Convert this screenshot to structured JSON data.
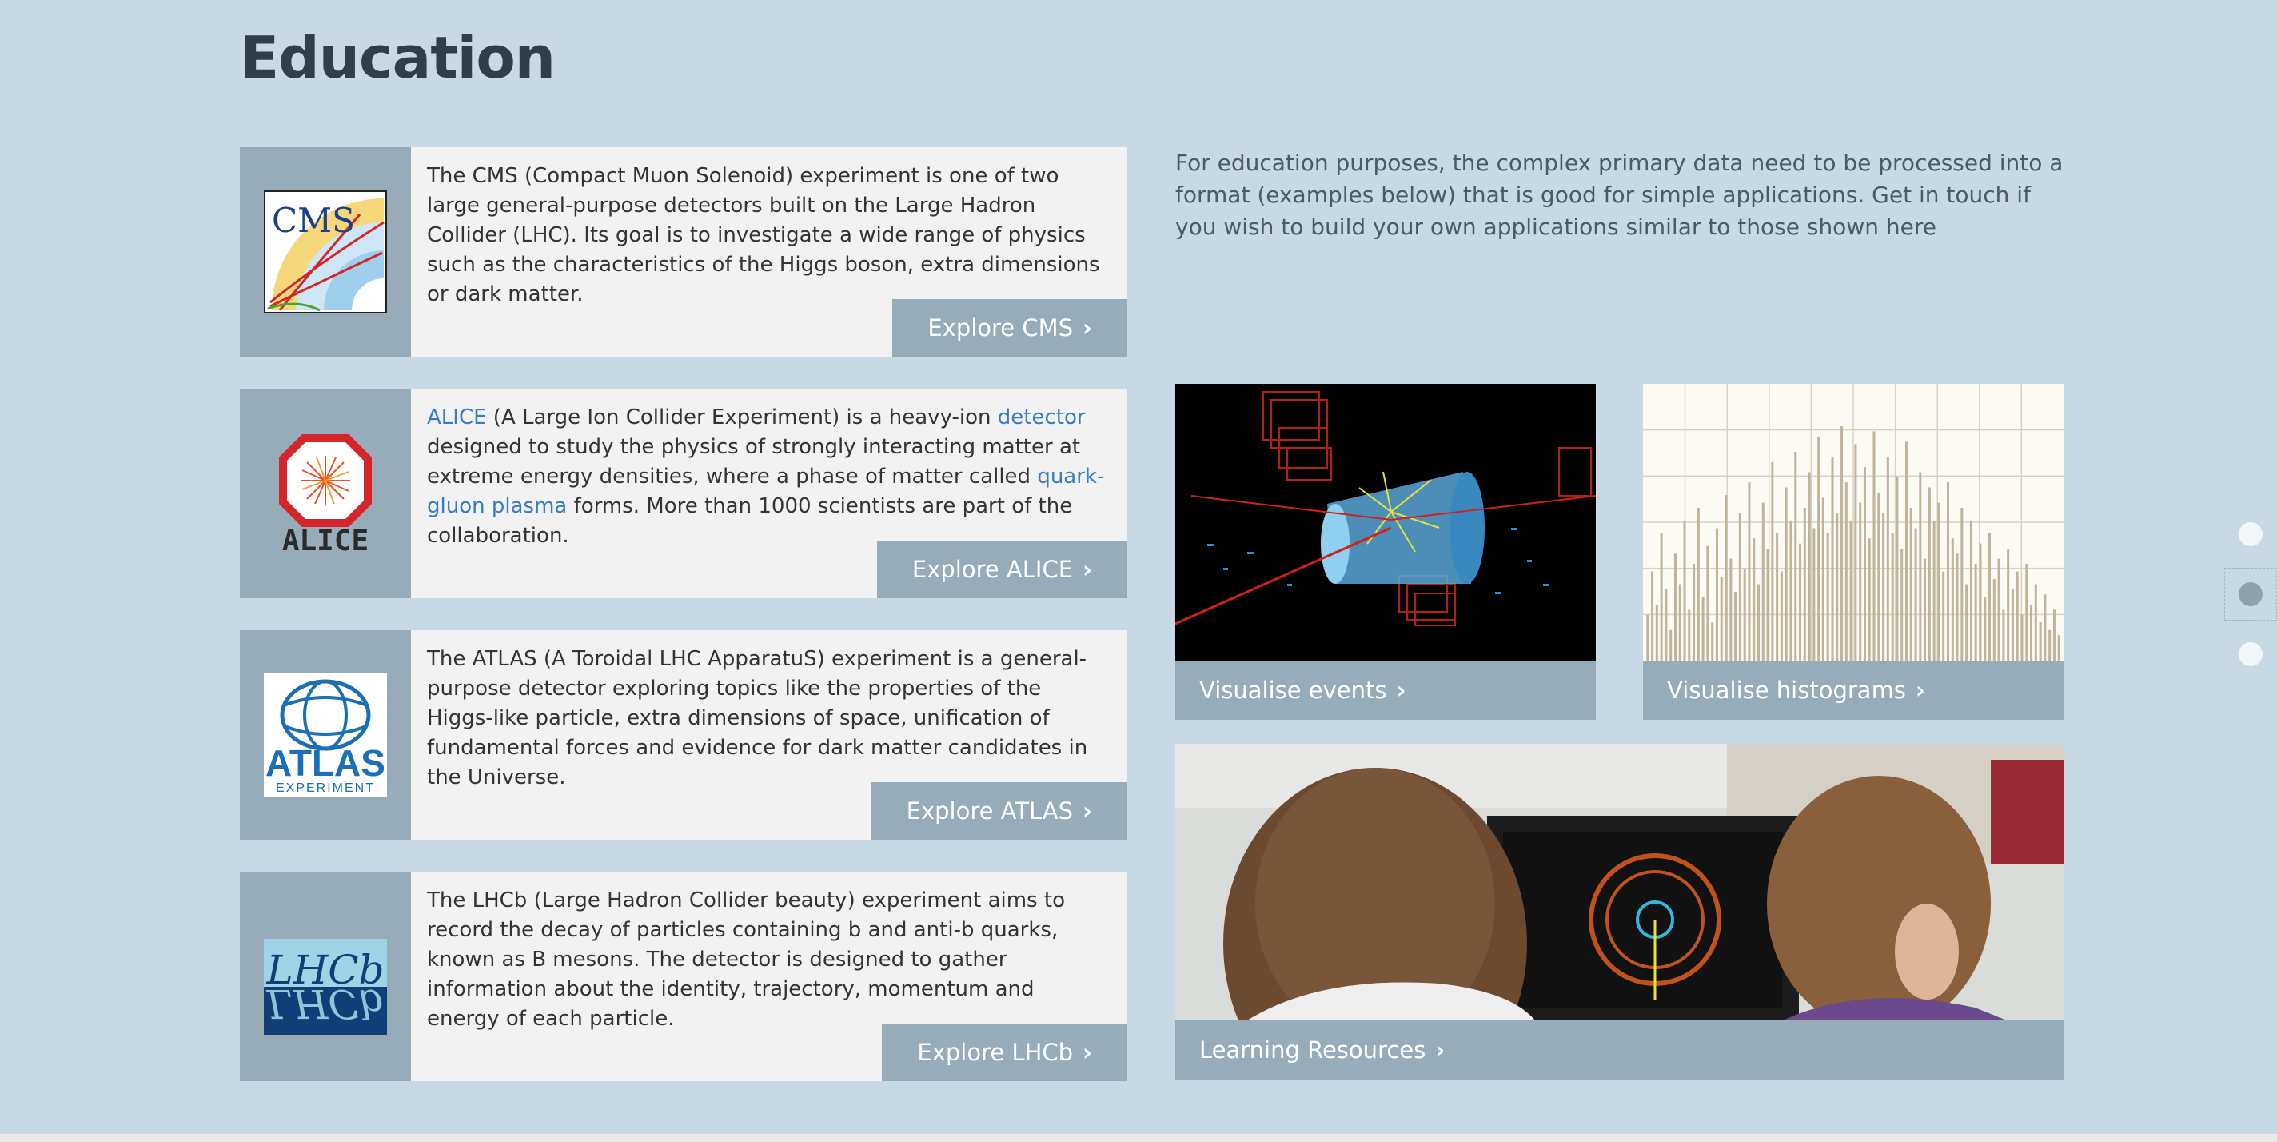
{
  "page": {
    "title": "Education"
  },
  "experiments": [
    {
      "logo_text": "CMS",
      "description": "The CMS (Compact Muon Solenoid) experiment is one of two large general-purpose detectors built on the Large Hadron Collider (LHC). Its goal is to investigate a wide range of physics such as the characteristics of the Higgs boson, extra dimensions or dark matter.",
      "button_label": "Explore CMS"
    },
    {
      "logo_text": "ALICE",
      "link_alice": "ALICE",
      "desc_part1": " (A Large Ion Collider Experiment) is a heavy-ion ",
      "link_detector": "detector",
      "desc_part2": " designed to study the physics of strongly interacting matter at extreme energy densities, where a phase of matter called ",
      "link_qgp": "quark-gluon plasma",
      "desc_part3": " forms. More than 1000 scientists are part of the collaboration.",
      "button_label": "Explore ALICE"
    },
    {
      "logo_text": "ATLAS",
      "logo_subtext": "EXPERIMENT",
      "description": "The ATLAS (A Toroidal LHC ApparatuS) experiment is a general-purpose detector exploring topics like the properties of the Higgs-like particle, extra dimensions of space, unification of fundamental forces and evidence for dark matter candidates in the Universe.",
      "button_label": "Explore ATLAS"
    },
    {
      "logo_text": "LHCb",
      "description": "The LHCb (Large Hadron Collider beauty) experiment aims to record the decay of particles containing b and anti-b quarks, known as B mesons. The detector is designed to gather information about the identity, trajectory, momentum and energy of each particle.",
      "button_label": "Explore LHCb"
    }
  ],
  "intro": {
    "text": "For education purposes, the complex primary data need to be processed into a format (examples below) that is good for simple applications. Get in touch if you wish to build your own applications similar to those shown here"
  },
  "tiles": {
    "events": "Visualise events",
    "histograms": "Visualise histograms",
    "learning": "Learning Resources"
  },
  "histogram_heights": [
    0.18,
    0.35,
    0.22,
    0.5,
    0.28,
    0.12,
    0.42,
    0.3,
    0.55,
    0.2,
    0.38,
    0.6,
    0.25,
    0.45,
    0.15,
    0.52,
    0.33,
    0.65,
    0.4,
    0.27,
    0.58,
    0.36,
    0.7,
    0.48,
    0.3,
    0.62,
    0.44,
    0.78,
    0.5,
    0.35,
    0.68,
    0.55,
    0.82,
    0.46,
    0.6,
    0.74,
    0.52,
    0.88,
    0.64,
    0.5,
    0.8,
    0.58,
    0.92,
    0.7,
    0.55,
    0.85,
    0.62,
    0.76,
    0.48,
    0.9,
    0.66,
    0.58,
    0.8,
    0.5,
    0.72,
    0.44,
    0.86,
    0.6,
    0.52,
    0.74,
    0.4,
    0.68,
    0.55,
    0.62,
    0.35,
    0.7,
    0.48,
    0.42,
    0.6,
    0.3,
    0.55,
    0.38,
    0.46,
    0.25,
    0.5,
    0.32,
    0.4,
    0.2,
    0.44,
    0.28,
    0.35,
    0.18,
    0.38,
    0.22,
    0.3,
    0.15,
    0.26,
    0.12,
    0.2,
    0.1
  ],
  "colors": {
    "background": "#c8d9e3",
    "panel": "#97acb8",
    "card": "#f2f2f2",
    "link": "#3a7cc0",
    "title": "#2f3e4a"
  },
  "nav_dots": {
    "count": 3,
    "active_index": 1
  }
}
